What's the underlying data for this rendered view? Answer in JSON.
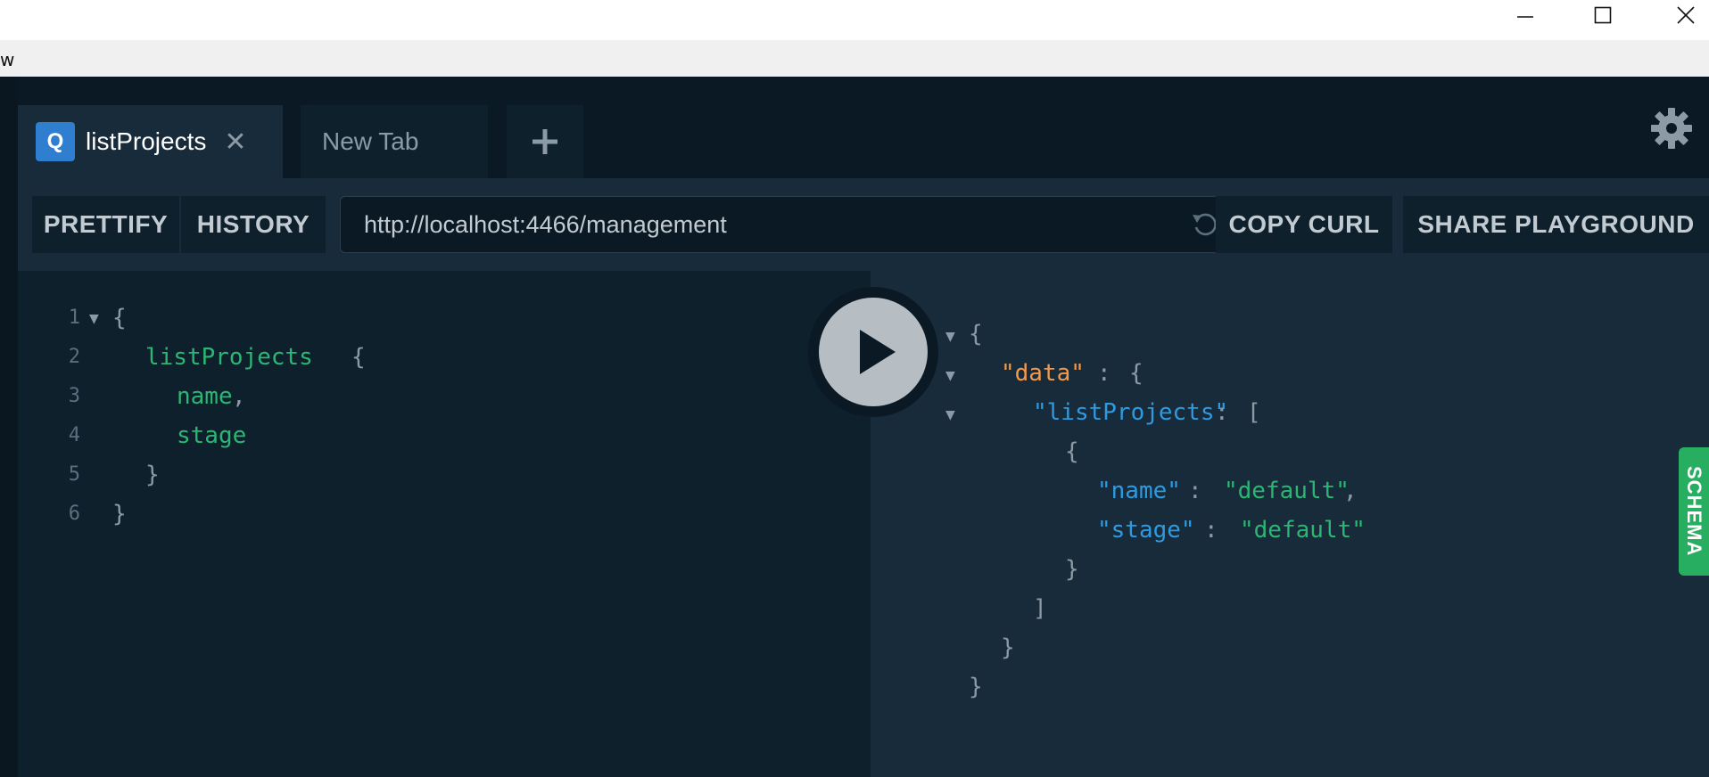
{
  "window": {
    "minimize_icon": "minimize-icon",
    "maximize_icon": "maximize-icon",
    "close_icon": "close-icon"
  },
  "menubar": {
    "visible_text": "w"
  },
  "tabs": [
    {
      "badge": "Q",
      "label": "listProjects",
      "active": true
    },
    {
      "label": "New Tab",
      "active": false
    }
  ],
  "add_tab_label": "+",
  "toolbar": {
    "prettify": "PRETTIFY",
    "history": "HISTORY",
    "endpoint": "http://localhost:4466/management",
    "copy_curl": "COPY CURL",
    "share": "SHARE PLAYGROUND"
  },
  "query": {
    "line_numbers": [
      "1",
      "2",
      "3",
      "4",
      "5",
      "6"
    ],
    "lines": [
      "{",
      "listProjects",
      "{",
      "name",
      ",",
      "stage",
      "}",
      "}"
    ]
  },
  "result": {
    "open_brace": "{",
    "data_key": "\"data\"",
    "colon": ":",
    "list_key": "\"listProjects\"",
    "open_bracket": "[",
    "item_open": "{",
    "name_key": "\"name\"",
    "name_value": "\"default\"",
    "comma": ",",
    "stage_key": "\"stage\"",
    "stage_value": "\"default\"",
    "item_close": "}",
    "close_bracket": "]",
    "data_close": "}",
    "close_brace": "}"
  },
  "schema_label": "SCHEMA",
  "colors": {
    "accent_green": "#2bb673",
    "key_orange": "#f2994a",
    "key_blue": "#2f9ae0",
    "badge_blue": "#2f7ecf"
  }
}
